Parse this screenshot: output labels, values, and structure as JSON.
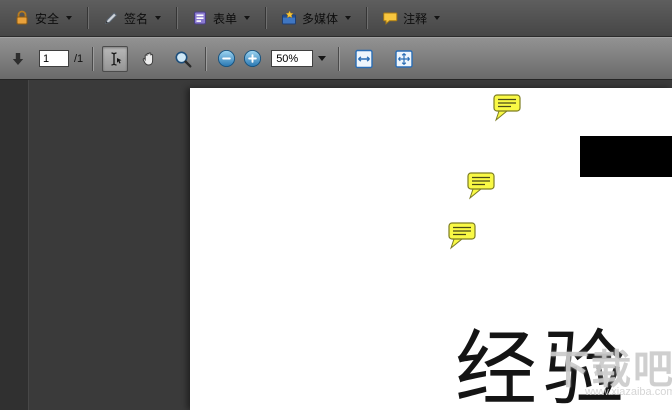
{
  "toolbar_top": {
    "buttons": [
      {
        "label": "安全",
        "icon": "lock-icon"
      },
      {
        "label": "签名",
        "icon": "pen-icon"
      },
      {
        "label": "表单",
        "icon": "form-icon"
      },
      {
        "label": "多媒体",
        "icon": "multimedia-icon"
      },
      {
        "label": "注释",
        "icon": "comment-icon"
      }
    ]
  },
  "toolbar_nav": {
    "current_page": "1",
    "page_count_label": "/1",
    "zoom_level": "50%"
  },
  "document": {
    "heading": "经验",
    "comment_marker_count": 3
  },
  "watermark": {
    "site_name": "下载吧",
    "site_url": "www.xiazaiba.com"
  },
  "colors": {
    "toolbar_dark": "#4c4c4c",
    "toolbar_light": "#7e7e7e",
    "content_background": "#3a3a3a",
    "annotation_yellow": "#f9f945",
    "zoom_button_blue": "#2877b2",
    "fit_icon_blue": "#2a6db5"
  }
}
